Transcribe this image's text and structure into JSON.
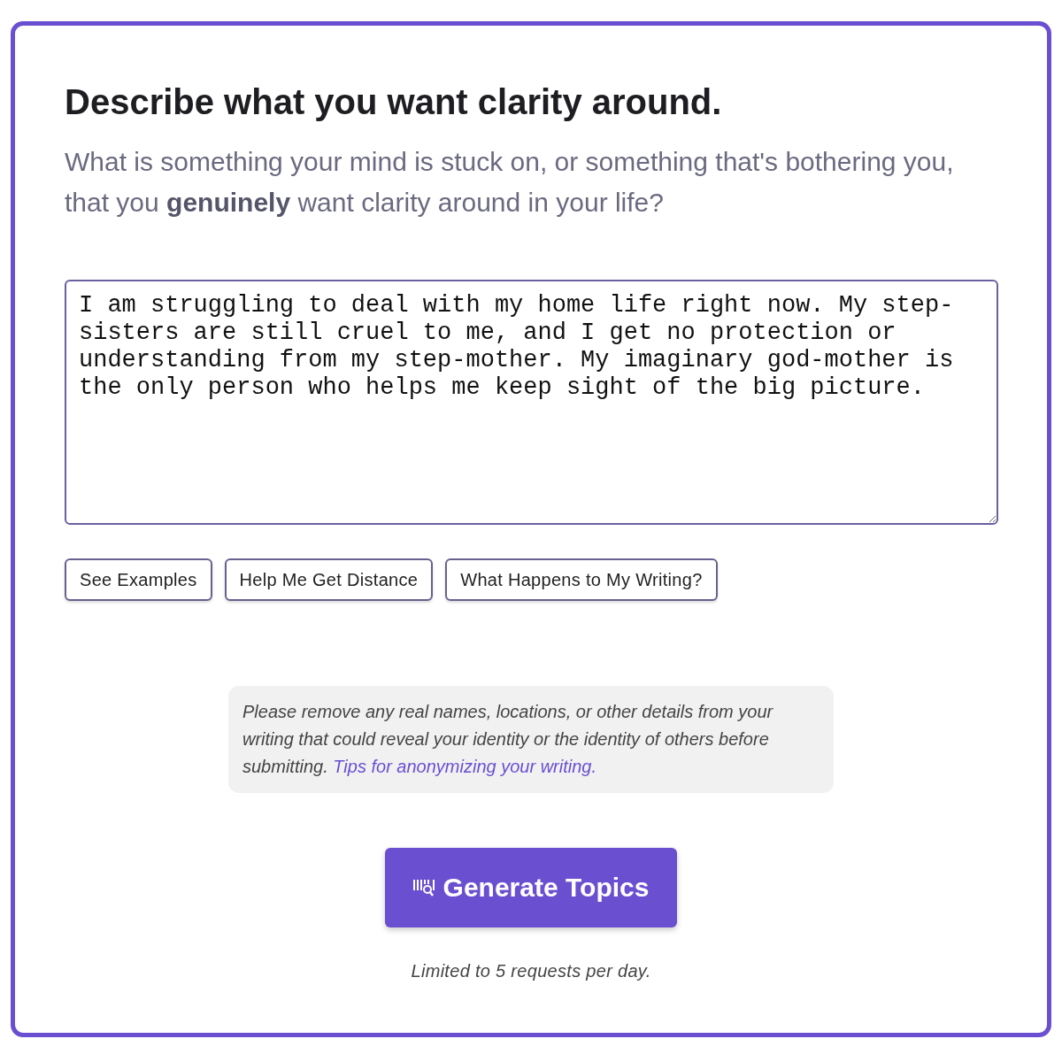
{
  "heading": "Describe what you want clarity around.",
  "subtitle": "What is something your mind is stuck on, or something that's bothering you, that you **genuinely** want clarity around in your life?",
  "textarea": {
    "value": "I am struggling to deal with my home life right now. My step-sisters are still cruel to me, and I get no protection or understanding from my step-mother. My imaginary god-mother is the only person who helps me keep sight of the big picture."
  },
  "buttons": [
    "See Examples",
    "Help Me Get Distance",
    "What Happens to My Writing?"
  ],
  "notice": {
    "text": "Please remove any real names, locations, or other details from your writing that could reveal your identity or the identity of others before submitting.",
    "link": "Tips for anonymizing your writing."
  },
  "submit": {
    "label": "Generate Topics"
  },
  "footer": "Limited to 5 requests per day."
}
